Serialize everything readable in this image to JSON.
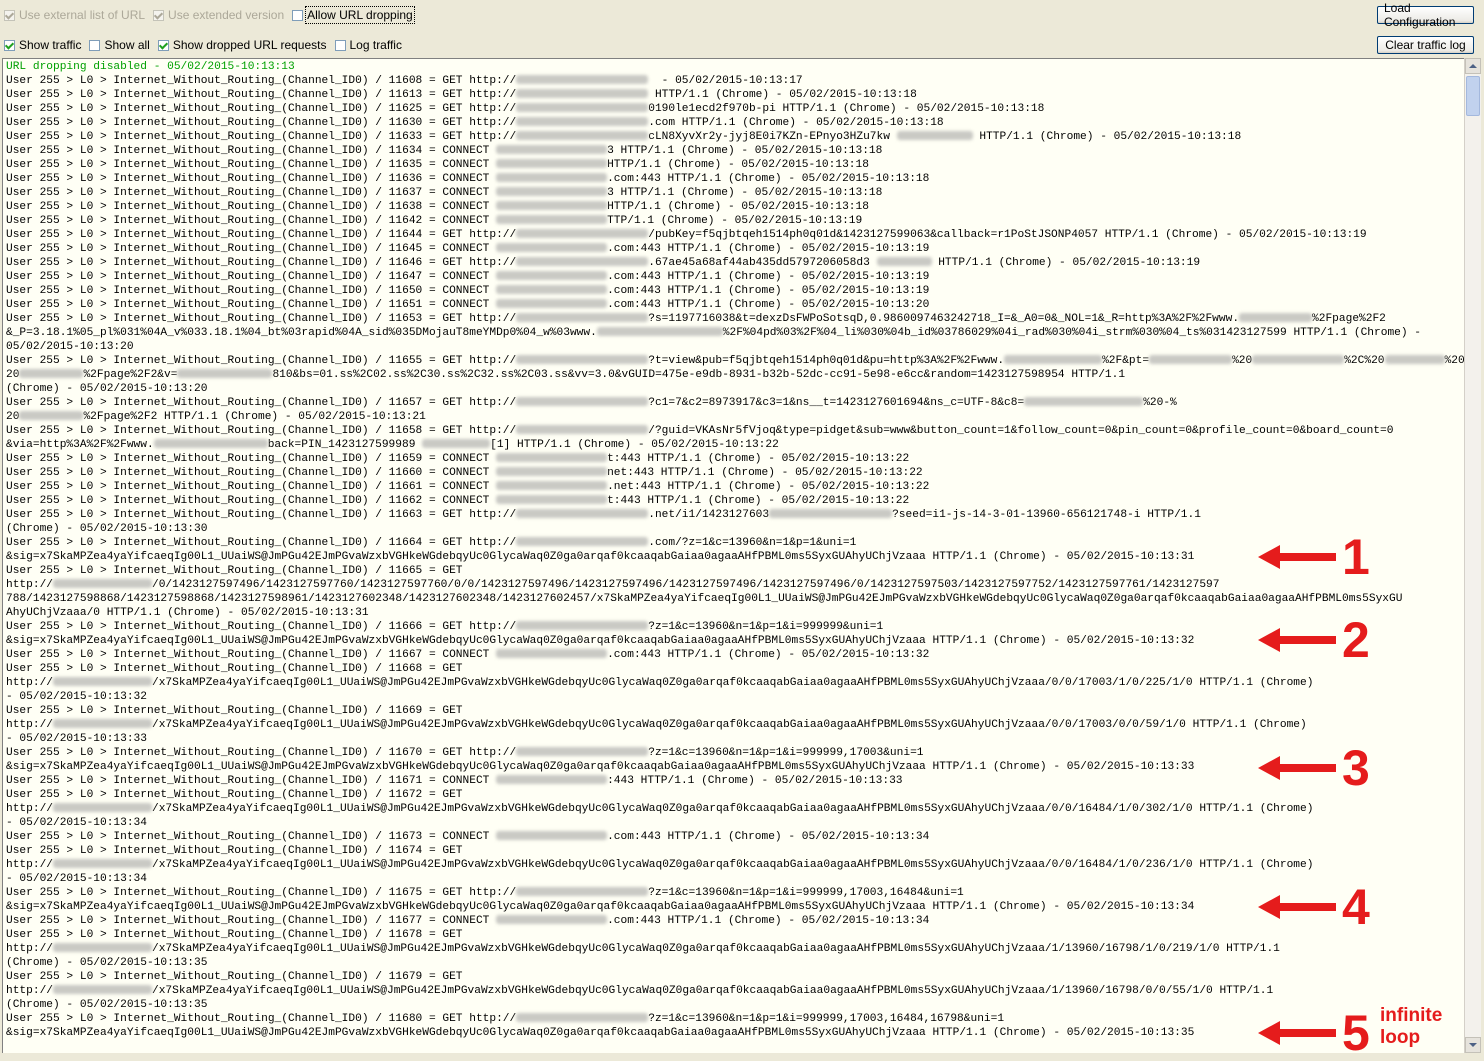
{
  "toolbar": {
    "checkboxes_row1": [
      {
        "label": "Use external list of URL",
        "checked": true,
        "disabled": true
      },
      {
        "label": "Use extended version",
        "checked": true,
        "disabled": true
      },
      {
        "label": "Allow URL dropping",
        "checked": false,
        "disabled": false,
        "focused": true
      }
    ],
    "checkboxes_row2": [
      {
        "label": "Show traffic",
        "checked": true
      },
      {
        "label": "Show all",
        "checked": false
      },
      {
        "label": "Show dropped URL requests",
        "checked": true
      },
      {
        "label": "Log traffic",
        "checked": false
      }
    ],
    "load_button": "Load Configuration",
    "clear_button": "Clear traffic log"
  },
  "log_lines": [
    {
      "text": "URL dropping disabled - 05/02/2015-10:13:13",
      "color": "#00a000"
    },
    {
      "text": "User 255 > L0 > Internet_Without_Routing_(Channel_ID0) / 11608 = GET http://[[]]  - 05/02/2015-10:13:17"
    },
    {
      "text": "User 255 > L0 > Internet_Without_Routing_(Channel_ID0) / 11613 = GET http://[[]] HTTP/1.1 (Chrome) - 05/02/2015-10:13:18"
    },
    {
      "text": "User 255 > L0 > Internet_Without_Routing_(Channel_ID0) / 11625 = GET http://[[]]0190le1ecd2f970b-pi HTTP/1.1 (Chrome) - 05/02/2015-10:13:18"
    },
    {
      "text": "User 255 > L0 > Internet_Without_Routing_(Channel_ID0) / 11630 = GET http://[[]].com HTTP/1.1 (Chrome) - 05/02/2015-10:13:18"
    },
    {
      "text": "User 255 > L0 > Internet_Without_Routing_(Channel_ID0) / 11633 = GET http://[[]]cLN8XyvXr2y-jyj8E0i7KZn-EPnyo3HZu7kw [[]] HTTP/1.1 (Chrome) - 05/02/2015-10:13:18"
    },
    {
      "text": "User 255 > L0 > Internet_Without_Routing_(Channel_ID0) / 11634 = CONNECT [[]]3 HTTP/1.1 (Chrome) - 05/02/2015-10:13:18"
    },
    {
      "text": "User 255 > L0 > Internet_Without_Routing_(Channel_ID0) / 11635 = CONNECT [[]]HTTP/1.1 (Chrome) - 05/02/2015-10:13:18"
    },
    {
      "text": "User 255 > L0 > Internet_Without_Routing_(Channel_ID0) / 11636 = CONNECT [[]].com:443 HTTP/1.1 (Chrome) - 05/02/2015-10:13:18"
    },
    {
      "text": "User 255 > L0 > Internet_Without_Routing_(Channel_ID0) / 11637 = CONNECT [[]]3 HTTP/1.1 (Chrome) - 05/02/2015-10:13:18"
    },
    {
      "text": "User 255 > L0 > Internet_Without_Routing_(Channel_ID0) / 11638 = CONNECT [[]]HTTP/1.1 (Chrome) - 05/02/2015-10:13:18"
    },
    {
      "text": "User 255 > L0 > Internet_Without_Routing_(Channel_ID0) / 11642 = CONNECT [[]]TTP/1.1 (Chrome) - 05/02/2015-10:13:19"
    },
    {
      "text": "User 255 > L0 > Internet_Without_Routing_(Channel_ID0) / 11644 = GET http://[[]]/pubKey=f5qjbtqeh1514ph0q01d&1423127599063&callback=r1PoStJSONP4057 HTTP/1.1 (Chrome) - 05/02/2015-10:13:19"
    },
    {
      "text": "User 255 > L0 > Internet_Without_Routing_(Channel_ID0) / 11645 = CONNECT [[]].com:443 HTTP/1.1 (Chrome) - 05/02/2015-10:13:19"
    },
    {
      "text": "User 255 > L0 > Internet_Without_Routing_(Channel_ID0) / 11646 = GET http://[[]].67ae45a68af44ab435dd5797206058d3 [[]] HTTP/1.1 (Chrome) - 05/02/2015-10:13:19"
    },
    {
      "text": "User 255 > L0 > Internet_Without_Routing_(Channel_ID0) / 11647 = CONNECT [[]].com:443 HTTP/1.1 (Chrome) - 05/02/2015-10:13:19"
    },
    {
      "text": "User 255 > L0 > Internet_Without_Routing_(Channel_ID0) / 11650 = CONNECT [[]].com:443 HTTP/1.1 (Chrome) - 05/02/2015-10:13:19"
    },
    {
      "text": "User 255 > L0 > Internet_Without_Routing_(Channel_ID0) / 11651 = CONNECT [[]].com:443 HTTP/1.1 (Chrome) - 05/02/2015-10:13:20"
    },
    {
      "text": "User 255 > L0 > Internet_Without_Routing_(Channel_ID0) / 11653 = GET http://[[]]?s=1197716038&t=dexzDsFWPoSotsqD,0.9860097463242718_I=&_A0=0&_NOL=1&_R=http%3A%2F%2Fwww.[[]]%2Fpage%2F2"
    },
    {
      "text": "&_P=3.18.1%05_pl%031%04A_v%033.18.1%04_bt%03rapid%04A_sid%035DMojauT8meYMDp0%04_w%03www.[[]]%2F%04pd%03%2F%04_li%030%04b_id%03786029%04i_rad%030%04i_strm%030%04_ts%031423127599 HTTP/1.1 (Chrome) -"
    },
    {
      "text": "05/02/2015-10:13:20"
    },
    {
      "text": "User 255 > L0 > Internet_Without_Routing_(Channel_ID0) / 11655 = GET http://[[]]?t=view&pub=f5qjbtqeh1514ph0q01d&pu=http%3A%2F%2Fwww.[[]]%2F&pt=[[]]%20[[]]%2C%20[[]]%20-%"
    },
    {
      "text": "20[[]]%2Fpage%2F2&v=[[]]810&bs=01.ss%2C02.ss%2C30.ss%2C32.ss%2C03.ss&vv=3.0&vGUID=475e-e9db-8931-b32b-52dc-cc91-5e98-e6cc&random=1423127598954 HTTP/1.1"
    },
    {
      "text": "(Chrome) - 05/02/2015-10:13:20"
    },
    {
      "text": "User 255 > L0 > Internet_Without_Routing_(Channel_ID0) / 11657 = GET http://[[]]?c1=7&c2=8973917&c3=1&ns__t=1423127601694&ns_c=UTF-8&c8=[[]]%20-%"
    },
    {
      "text": "20[[]]%2Fpage%2F2 HTTP/1.1 (Chrome) - 05/02/2015-10:13:21"
    },
    {
      "text": "User 255 > L0 > Internet_Without_Routing_(Channel_ID0) / 11658 = GET http://[[]]/?guid=VKAsNr5fVjoq&type=pidget&sub=www&button_count=1&follow_count=0&pin_count=0&profile_count=0&board_count=0"
    },
    {
      "text": "&via=http%3A%2F%2Fwww.[[]]back=PIN_1423127599989 [[]][1] HTTP/1.1 (Chrome) - 05/02/2015-10:13:22"
    },
    {
      "text": "User 255 > L0 > Internet_Without_Routing_(Channel_ID0) / 11659 = CONNECT [[]]t:443 HTTP/1.1 (Chrome) - 05/02/2015-10:13:22"
    },
    {
      "text": "User 255 > L0 > Internet_Without_Routing_(Channel_ID0) / 11660 = CONNECT [[]]net:443 HTTP/1.1 (Chrome) - 05/02/2015-10:13:22"
    },
    {
      "text": "User 255 > L0 > Internet_Without_Routing_(Channel_ID0) / 11661 = CONNECT [[]].net:443 HTTP/1.1 (Chrome) - 05/02/2015-10:13:22"
    },
    {
      "text": "User 255 > L0 > Internet_Without_Routing_(Channel_ID0) / 11662 = CONNECT [[]]t:443 HTTP/1.1 (Chrome) - 05/02/2015-10:13:22"
    },
    {
      "text": "User 255 > L0 > Internet_Without_Routing_(Channel_ID0) / 11663 = GET http://[[]].net/i1/1423127603[[]]?seed=i1-js-14-3-01-13960-656121748-i HTTP/1.1"
    },
    {
      "text": "(Chrome) - 05/02/2015-10:13:30"
    },
    {
      "text": "User 255 > L0 > Internet_Without_Routing_(Channel_ID0) / 11664 = GET http://[[]].com/?z=1&c=13960&n=1&p=1&uni=1"
    },
    {
      "text": "&sig=x7SkaMPZea4yaYifcaeqIg00L1_UUaiWS@JmPGu42EJmPGvaWzxbVGHkeWGdebqyUc0GlycaWaq0Z0ga0arqaf0kcaaqabGaiaa0agaaAHfPBML0ms5SyxGUAhyUChjVzaaa HTTP/1.1 (Chrome) - 05/02/2015-10:13:31"
    },
    {
      "text": "User 255 > L0 > Internet_Without_Routing_(Channel_ID0) / 11665 = GET"
    },
    {
      "text": "http://[[]]/0/1423127597496/1423127597760/1423127597760/0/0/1423127597496/1423127597496/1423127597496/1423127597496/0/1423127597503/1423127597752/1423127597761/1423127597"
    },
    {
      "text": "788/1423127598868/1423127598868/1423127598961/1423127602348/1423127602348/1423127602457/x7SkaMPZea4yaYifcaeqIg00L1_UUaiWS@JmPGu42EJmPGvaWzxbVGHkeWGdebqyUc0GlycaWaq0Z0ga0arqaf0kcaaqabGaiaa0agaaAHfPBML0ms5SyxGU"
    },
    {
      "text": "AhyUChjVzaaa/0 HTTP/1.1 (Chrome) - 05/02/2015-10:13:31"
    },
    {
      "text": "User 255 > L0 > Internet_Without_Routing_(Channel_ID0) / 11666 = GET http://[[]]?z=1&c=13960&n=1&p=1&i=999999&uni=1"
    },
    {
      "text": "&sig=x7SkaMPZea4yaYifcaeqIg00L1_UUaiWS@JmPGu42EJmPGvaWzxbVGHkeWGdebqyUc0GlycaWaq0Z0ga0arqaf0kcaaqabGaiaa0agaaAHfPBML0ms5SyxGUAhyUChjVzaaa HTTP/1.1 (Chrome) - 05/02/2015-10:13:32"
    },
    {
      "text": "User 255 > L0 > Internet_Without_Routing_(Channel_ID0) / 11667 = CONNECT [[]].com:443 HTTP/1.1 (Chrome) - 05/02/2015-10:13:32"
    },
    {
      "text": "User 255 > L0 > Internet_Without_Routing_(Channel_ID0) / 11668 = GET"
    },
    {
      "text": "http://[[]]/x7SkaMPZea4yaYifcaeqIg00L1_UUaiWS@JmPGu42EJmPGvaWzxbVGHkeWGdebqyUc0GlycaWaq0Z0ga0arqaf0kcaaqabGaiaa0agaaAHfPBML0ms5SyxGUAhyUChjVzaaa/0/0/17003/1/0/225/1/0 HTTP/1.1 (Chrome)"
    },
    {
      "text": "- 05/02/2015-10:13:32"
    },
    {
      "text": "User 255 > L0 > Internet_Without_Routing_(Channel_ID0) / 11669 = GET"
    },
    {
      "text": "http://[[]]/x7SkaMPZea4yaYifcaeqIg00L1_UUaiWS@JmPGu42EJmPGvaWzxbVGHkeWGdebqyUc0GlycaWaq0Z0ga0arqaf0kcaaqabGaiaa0agaaAHfPBML0ms5SyxGUAhyUChjVzaaa/0/0/17003/0/0/59/1/0 HTTP/1.1 (Chrome)"
    },
    {
      "text": "- 05/02/2015-10:13:33"
    },
    {
      "text": "User 255 > L0 > Internet_Without_Routing_(Channel_ID0) / 11670 = GET http://[[]]?z=1&c=13960&n=1&p=1&i=999999,17003&uni=1"
    },
    {
      "text": "&sig=x7SkaMPZea4yaYifcaeqIg00L1_UUaiWS@JmPGu42EJmPGvaWzxbVGHkeWGdebqyUc0GlycaWaq0Z0ga0arqaf0kcaaqabGaiaa0agaaAHfPBML0ms5SyxGUAhyUChjVzaaa HTTP/1.1 (Chrome) - 05/02/2015-10:13:33"
    },
    {
      "text": "User 255 > L0 > Internet_Without_Routing_(Channel_ID0) / 11671 = CONNECT [[]]:443 HTTP/1.1 (Chrome) - 05/02/2015-10:13:33"
    },
    {
      "text": "User 255 > L0 > Internet_Without_Routing_(Channel_ID0) / 11672 = GET"
    },
    {
      "text": "http://[[]]/x7SkaMPZea4yaYifcaeqIg00L1_UUaiWS@JmPGu42EJmPGvaWzxbVGHkeWGdebqyUc0GlycaWaq0Z0ga0arqaf0kcaaqabGaiaa0agaaAHfPBML0ms5SyxGUAhyUChjVzaaa/0/0/16484/1/0/302/1/0 HTTP/1.1 (Chrome)"
    },
    {
      "text": "- 05/02/2015-10:13:34"
    },
    {
      "text": "User 255 > L0 > Internet_Without_Routing_(Channel_ID0) / 11673 = CONNECT [[]].com:443 HTTP/1.1 (Chrome) - 05/02/2015-10:13:34"
    },
    {
      "text": "User 255 > L0 > Internet_Without_Routing_(Channel_ID0) / 11674 = GET"
    },
    {
      "text": "http://[[]]/x7SkaMPZea4yaYifcaeqIg00L1_UUaiWS@JmPGu42EJmPGvaWzxbVGHkeWGdebqyUc0GlycaWaq0Z0ga0arqaf0kcaaqabGaiaa0agaaAHfPBML0ms5SyxGUAhyUChjVzaaa/0/0/16484/1/0/236/1/0 HTTP/1.1 (Chrome)"
    },
    {
      "text": "- 05/02/2015-10:13:34"
    },
    {
      "text": "User 255 > L0 > Internet_Without_Routing_(Channel_ID0) / 11675 = GET http://[[]]?z=1&c=13960&n=1&p=1&i=999999,17003,16484&uni=1"
    },
    {
      "text": "&sig=x7SkaMPZea4yaYifcaeqIg00L1_UUaiWS@JmPGu42EJmPGvaWzxbVGHkeWGdebqyUc0GlycaWaq0Z0ga0arqaf0kcaaqabGaiaa0agaaAHfPBML0ms5SyxGUAhyUChjVzaaa HTTP/1.1 (Chrome) - 05/02/2015-10:13:34"
    },
    {
      "text": "User 255 > L0 > Internet_Without_Routing_(Channel_ID0) / 11677 = CONNECT [[]].com:443 HTTP/1.1 (Chrome) - 05/02/2015-10:13:34"
    },
    {
      "text": "User 255 > L0 > Internet_Without_Routing_(Channel_ID0) / 11678 = GET"
    },
    {
      "text": "http://[[]]/x7SkaMPZea4yaYifcaeqIg00L1_UUaiWS@JmPGu42EJmPGvaWzxbVGHkeWGdebqyUc0GlycaWaq0Z0ga0arqaf0kcaaqabGaiaa0agaaAHfPBML0ms5SyxGUAhyUChjVzaaa/1/13960/16798/1/0/219/1/0 HTTP/1.1"
    },
    {
      "text": "(Chrome) - 05/02/2015-10:13:35"
    },
    {
      "text": "User 255 > L0 > Internet_Without_Routing_(Channel_ID0) / 11679 = GET"
    },
    {
      "text": "http://[[]]/x7SkaMPZea4yaYifcaeqIg00L1_UUaiWS@JmPGu42EJmPGvaWzxbVGHkeWGdebqyUc0GlycaWaq0Z0ga0arqaf0kcaaqabGaiaa0agaaAHfPBML0ms5SyxGUAhyUChjVzaaa/1/13960/16798/0/0/55/1/0 HTTP/1.1"
    },
    {
      "text": "(Chrome) - 05/02/2015-10:13:35"
    },
    {
      "text": "User 255 > L0 > Internet_Without_Routing_(Channel_ID0) / 11680 = GET http://[[]]?z=1&c=13960&n=1&p=1&i=999999,17003,16484,16798&uni=1"
    },
    {
      "text": "&sig=x7SkaMPZea4yaYifcaeqIg00L1_UUaiWS@JmPGu42EJmPGvaWzxbVGHkeWGdebqyUc0GlycaWaq0Z0ga0arqaf0kcaaqabGaiaa0agaaAHfPBML0ms5SyxGUAhyUChjVzaaa HTTP/1.1 (Chrome) - 05/02/2015-10:13:35"
    }
  ],
  "annotations": [
    {
      "number": "1"
    },
    {
      "number": "2"
    },
    {
      "number": "3"
    },
    {
      "number": "4"
    },
    {
      "number": "5",
      "note_line1": "infinite",
      "note_line2": "loop"
    }
  ],
  "colors": {
    "annotation": "#e51c1c",
    "status_green": "#00a000",
    "log_background": "#fffff5"
  },
  "icons": {
    "scroll_up": "triangle-up-icon",
    "scroll_down": "triangle-down-icon",
    "check": "checkmark-icon"
  }
}
